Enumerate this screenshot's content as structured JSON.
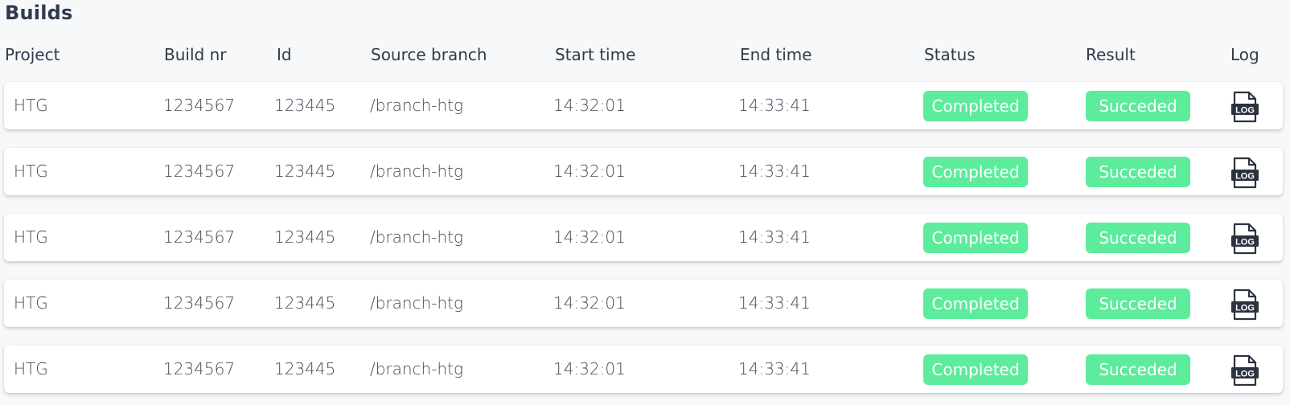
{
  "page": {
    "title": "Builds"
  },
  "table": {
    "headers": {
      "project": "Project",
      "build_nr": "Build nr",
      "id": "Id",
      "source_branch": "Source branch",
      "start_time": "Start time",
      "end_time": "End time",
      "status": "Status",
      "result": "Result",
      "log": "Log"
    },
    "rows": [
      {
        "project": "HTG",
        "build_nr": "1234567",
        "id": "123445",
        "source_branch": "/branch-htg",
        "start_time": "14:32:01",
        "end_time": "14:33:41",
        "status": "Completed",
        "result": "Succeded",
        "log_icon": "log-file-icon"
      },
      {
        "project": "HTG",
        "build_nr": "1234567",
        "id": "123445",
        "source_branch": "/branch-htg",
        "start_time": "14:32:01",
        "end_time": "14:33:41",
        "status": "Completed",
        "result": "Succeded",
        "log_icon": "log-file-icon"
      },
      {
        "project": "HTG",
        "build_nr": "1234567",
        "id": "123445",
        "source_branch": "/branch-htg",
        "start_time": "14:32:01",
        "end_time": "14:33:41",
        "status": "Completed",
        "result": "Succeded",
        "log_icon": "log-file-icon"
      },
      {
        "project": "HTG",
        "build_nr": "1234567",
        "id": "123445",
        "source_branch": "/branch-htg",
        "start_time": "14:32:01",
        "end_time": "14:33:41",
        "status": "Completed",
        "result": "Succeded",
        "log_icon": "log-file-icon"
      },
      {
        "project": "HTG",
        "build_nr": "1234567",
        "id": "123445",
        "source_branch": "/branch-htg",
        "start_time": "14:32:01",
        "end_time": "14:33:41",
        "status": "Completed",
        "result": "Succeded",
        "log_icon": "log-file-icon"
      }
    ],
    "log_icon_text": "LOG"
  },
  "colors": {
    "status_badge": "#5cec9c",
    "badge_text": "#ffffff",
    "background": "#f7f8f9",
    "row_background": "#ffffff",
    "title": "#2f3a4c"
  }
}
